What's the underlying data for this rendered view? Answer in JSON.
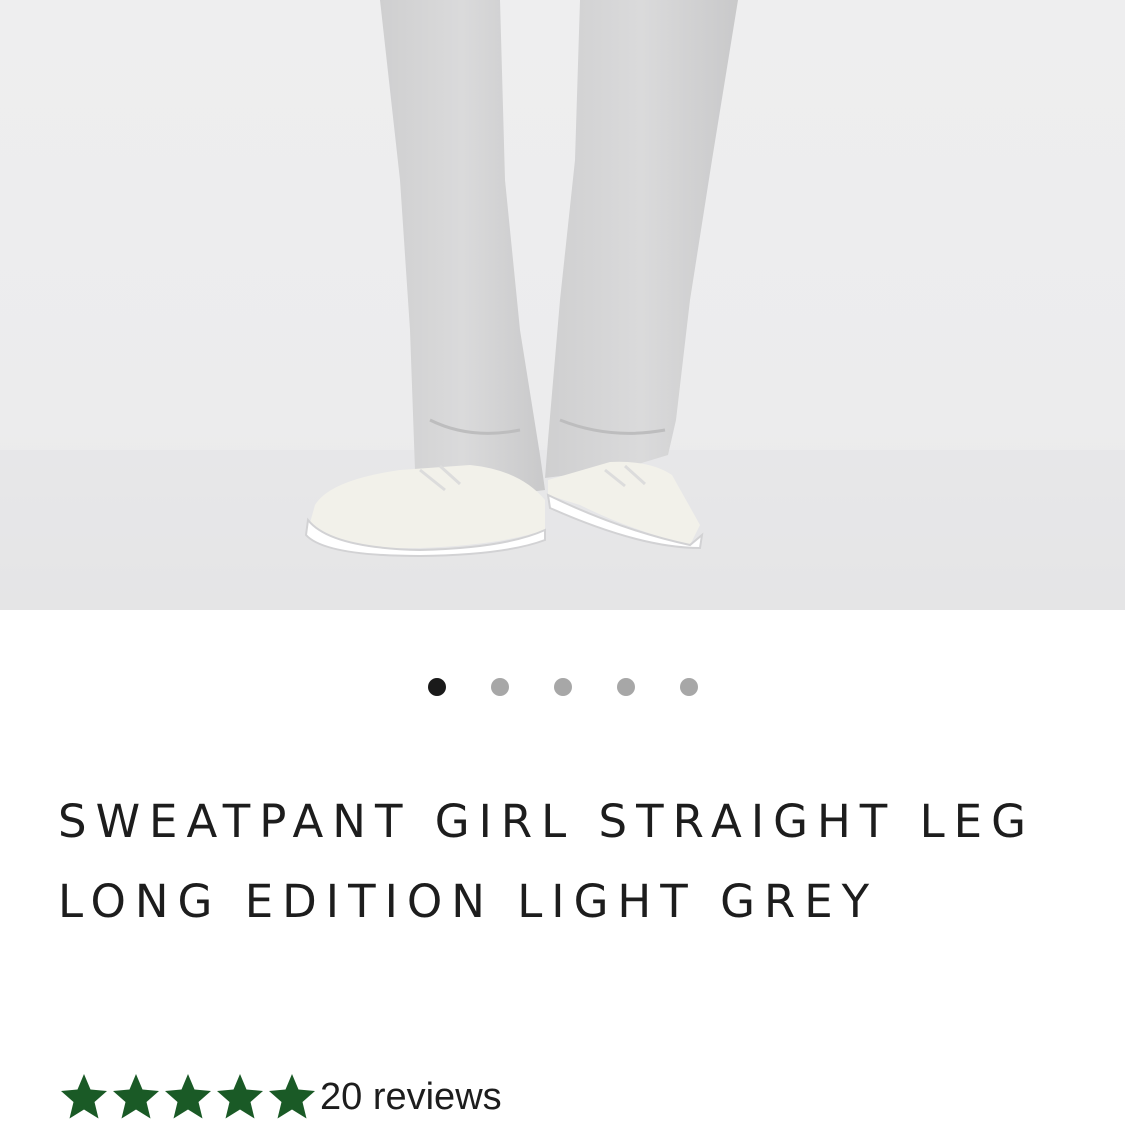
{
  "product": {
    "image_alt_icon": "product-photo",
    "title": "SWEATPANT GIRL STRAIGHT LEG LONG EDITION LIGHT GREY",
    "rating": {
      "stars_filled": 5,
      "stars_total": 5,
      "reviews_label": "20 reviews"
    }
  },
  "carousel": {
    "count": 5,
    "active_index": 0
  },
  "colors": {
    "star": "#1a5a26",
    "dot_active": "#1a1a1a",
    "dot_inactive": "#a7a7a7",
    "background_photo": "#eeeeee"
  }
}
